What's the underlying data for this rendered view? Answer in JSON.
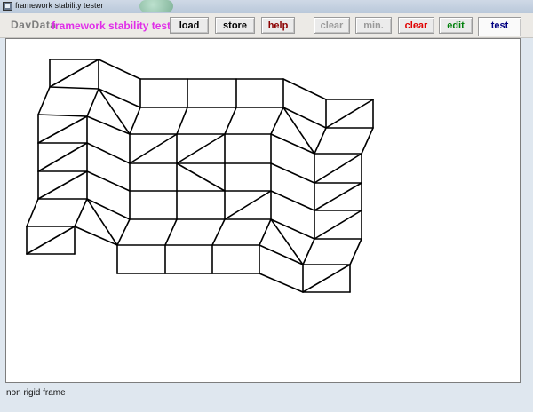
{
  "window": {
    "title": "framework stability tester"
  },
  "toolbar": {
    "brand": "DavData",
    "app_title": "framework stability tester",
    "buttons": [
      {
        "label": "load",
        "color": "#000000"
      },
      {
        "label": "store",
        "color": "#000000"
      },
      {
        "label": "help",
        "color": "#8b0000"
      },
      {
        "label": "clear",
        "color": "#9a9a9a"
      },
      {
        "label": "min.",
        "color": "#9a9a9a"
      },
      {
        "label": "clear",
        "color": "#e00000"
      },
      {
        "label": "edit",
        "color": "#00800a"
      },
      {
        "label": "test",
        "color": "#000080"
      }
    ]
  },
  "status": {
    "text": "non rigid frame"
  }
}
